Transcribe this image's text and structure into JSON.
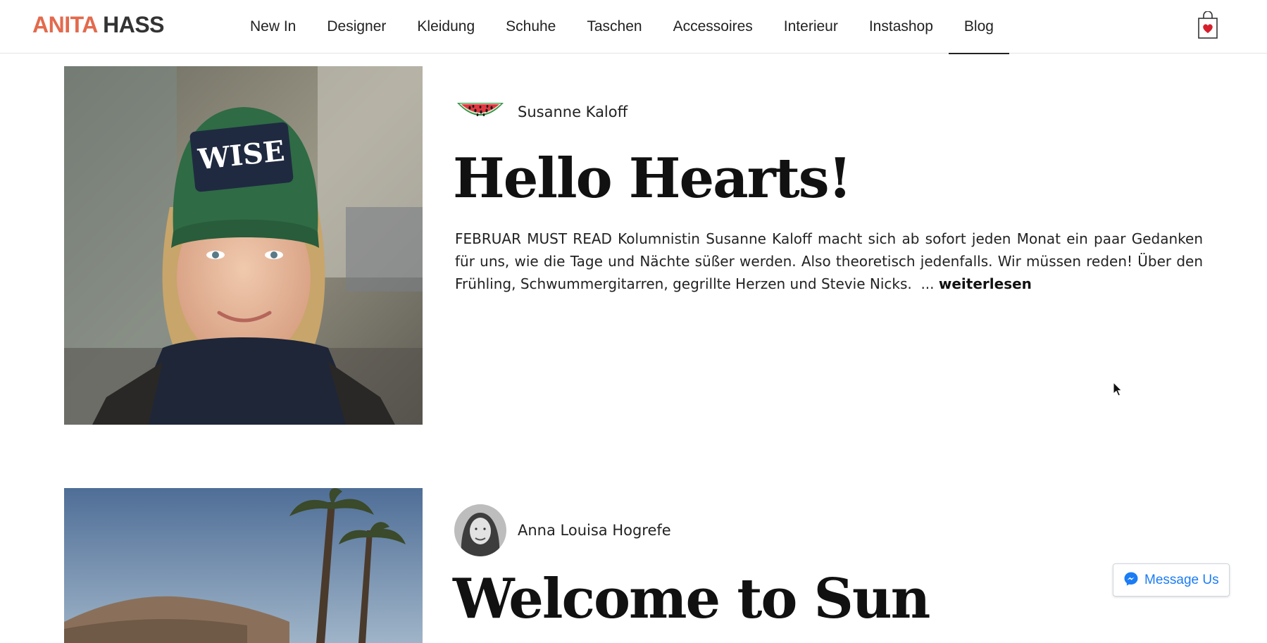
{
  "header": {
    "logo_part1": "ANITA",
    "logo_part2": " HASS",
    "nav": [
      {
        "label": "New In"
      },
      {
        "label": "Designer"
      },
      {
        "label": "Kleidung"
      },
      {
        "label": "Schuhe"
      },
      {
        "label": "Taschen"
      },
      {
        "label": "Accessoires"
      },
      {
        "label": "Interieur"
      },
      {
        "label": "Instashop"
      },
      {
        "label": "Blog"
      }
    ],
    "active_nav": "Blog",
    "cart_icon": "shopping-bag-heart-icon"
  },
  "posts": [
    {
      "author": "Susanne Kaloff",
      "avatar_icon": "watermelon-icon",
      "title": "Hello Hearts!",
      "excerpt": "FEBRUAR MUST READ Kolumnistin Susanne Kaloff macht sich ab sofort jeden Monat ein paar Gedanken für uns, wie die Tage und Nächte süßer werden. Also theoretisch jedenfalls. Wir müssen reden! Über den Frühling, Schwummergitarren, gegrillte Herzen und Stevie Nicks.",
      "ellipsis": "  ... ",
      "read_more": "weiterlesen"
    },
    {
      "author": "Anna Louisa Hogrefe",
      "title": "Welcome to Sun"
    }
  ],
  "messenger": {
    "label": "Message Us",
    "icon": "messenger-icon"
  },
  "colors": {
    "logo_accent": "#e36a4d",
    "messenger_blue": "#1c7cf4",
    "text": "#111111"
  }
}
